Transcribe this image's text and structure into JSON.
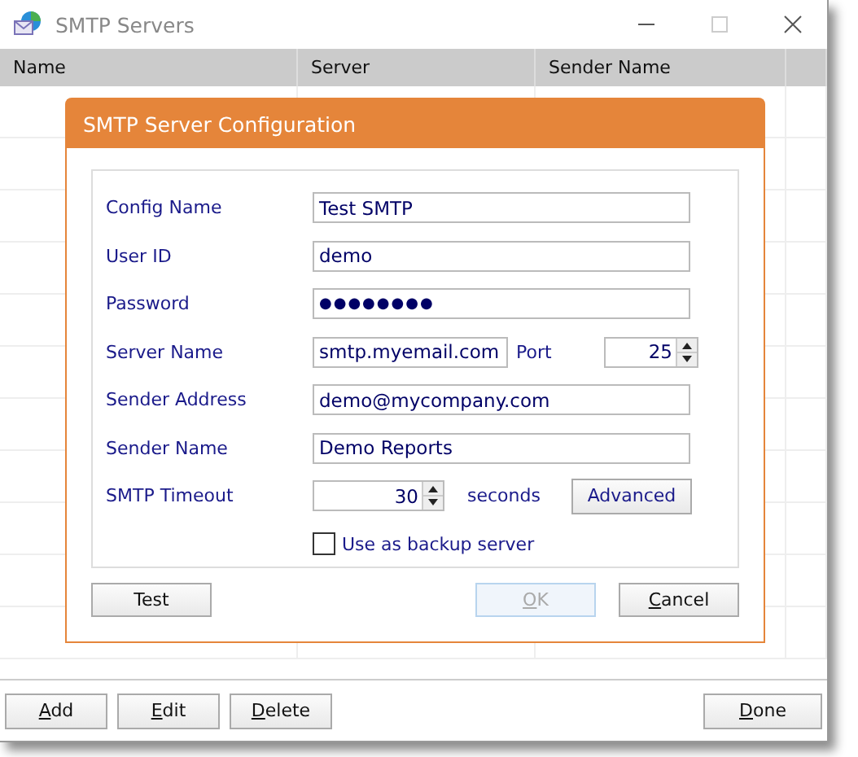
{
  "window": {
    "title": "SMTP Servers"
  },
  "table": {
    "columns": [
      "Name",
      "Server",
      "Sender Name"
    ]
  },
  "buttons": [
    {
      "label": "Add",
      "mnemonic": true
    },
    {
      "label": "Edit",
      "mnemonic": true
    },
    {
      "label": "Delete",
      "mnemonic": true
    },
    {
      "label": "Done",
      "mnemonic": true
    }
  ],
  "dialog": {
    "title": "SMTP Server Configuration",
    "fields": [
      {
        "kind": "text",
        "label": "Config Name",
        "value": "Test SMTP"
      },
      {
        "kind": "text",
        "label": "User ID",
        "value": "demo"
      },
      {
        "kind": "password",
        "label": "Password",
        "value": "●●●●●●●●"
      },
      {
        "kind": "server",
        "label": "Server Name",
        "value": "smtp.myemail.com",
        "port_label": "Port",
        "port": "25"
      },
      {
        "kind": "text",
        "label": "Sender Address",
        "value": "demo@mycompany.com"
      },
      {
        "kind": "text",
        "label": "Sender Name",
        "value": "Demo Reports"
      },
      {
        "kind": "timeout",
        "label": "SMTP Timeout",
        "value": "30",
        "unit": "seconds",
        "button": "Advanced"
      }
    ],
    "backup": {
      "label": "Use as backup server",
      "checked": false
    },
    "buttons": [
      {
        "label": "Test",
        "mnemonic": false,
        "disabled": false
      },
      {
        "label": "OK",
        "mnemonic": true,
        "disabled": true
      },
      {
        "label": "Cancel",
        "mnemonic": true,
        "disabled": false
      }
    ]
  }
}
